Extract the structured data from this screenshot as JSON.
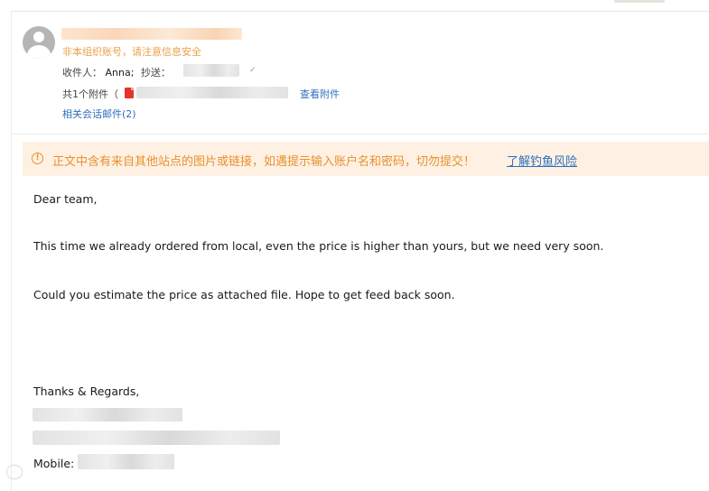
{
  "header": {
    "sender_warning": "非本组织账号，请注意信息安全",
    "recipients_label": "收件人：",
    "recipient_name": "Anna;",
    "cc_label": "抄送：",
    "attachment_summary": "共1个附件（",
    "view_attachments": "查看附件",
    "related_conversations": "相关会话邮件(2)"
  },
  "alert": {
    "text": "正文中含有来自其他站点的图片或链接，如遇提示输入账户名和密码，切勿提交！",
    "link": "了解钓鱼风险",
    "icon": "warning-circle-icon"
  },
  "body": {
    "greeting": "Dear team,",
    "paragraph1": "This time we already ordered from local, even the price is higher than yours, but we need very soon.",
    "paragraph2": "Could you estimate the price as attached file. Hope to get feed back soon.",
    "closing": "Thanks & Regards,",
    "mobile_label": "Mobile:"
  },
  "colors": {
    "warning_orange": "#e8a04a",
    "link_blue": "#2f6fbd",
    "alert_bg": "#fef1e3"
  }
}
